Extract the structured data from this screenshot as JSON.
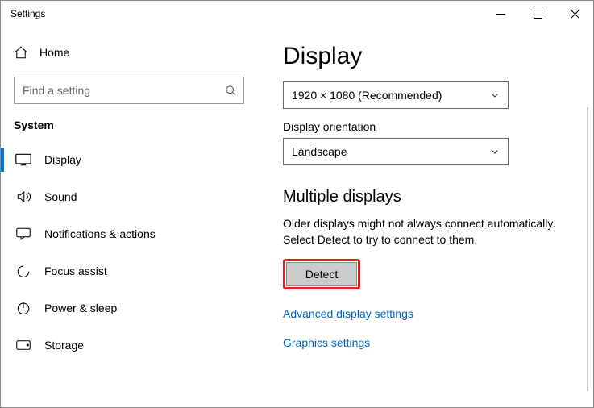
{
  "window": {
    "title": "Settings"
  },
  "sidebar": {
    "home": "Home",
    "search_placeholder": "Find a setting",
    "section": "System",
    "items": [
      {
        "label": "Display"
      },
      {
        "label": "Sound"
      },
      {
        "label": "Notifications & actions"
      },
      {
        "label": "Focus assist"
      },
      {
        "label": "Power & sleep"
      },
      {
        "label": "Storage"
      }
    ]
  },
  "main": {
    "title": "Display",
    "resolution": {
      "value": "1920 × 1080 (Recommended)"
    },
    "orientation": {
      "label": "Display orientation",
      "value": "Landscape"
    },
    "multiple": {
      "heading": "Multiple displays",
      "body": "Older displays might not always connect automatically. Select Detect to try to connect to them.",
      "detect": "Detect"
    },
    "links": {
      "advanced": "Advanced display settings",
      "graphics": "Graphics settings"
    }
  }
}
